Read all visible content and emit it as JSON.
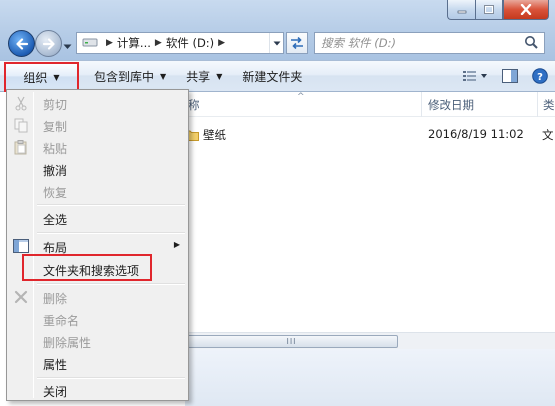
{
  "address": {
    "crumbs": [
      "计算...",
      "软件 (D:)"
    ],
    "separator": "▶"
  },
  "search": {
    "placeholder": "搜索 软件 (D:)"
  },
  "toolbar": {
    "organize": "组织",
    "include_in_library": "包含到库中",
    "share": "共享",
    "new_folder": "新建文件夹",
    "dropdown_glyph": "▼"
  },
  "columns": {
    "name": "称",
    "date": "修改日期",
    "type": "类",
    "sort_glyph": "^"
  },
  "files": [
    {
      "name": "壁纸",
      "date": "2016/8/19 11:02",
      "type": "文"
    }
  ],
  "scrollbar": {
    "grip": "III"
  },
  "menu": {
    "items": [
      {
        "label": "剪切",
        "enabled": false,
        "icon": "scissors-icon"
      },
      {
        "label": "复制",
        "enabled": false,
        "icon": "copy-icon"
      },
      {
        "label": "粘贴",
        "enabled": false,
        "icon": "paste-icon"
      },
      {
        "label": "撤消",
        "enabled": true,
        "icon": ""
      },
      {
        "label": "恢复",
        "enabled": false,
        "icon": ""
      },
      {
        "label": "全选",
        "enabled": true,
        "icon": ""
      },
      {
        "label": "布局",
        "enabled": true,
        "icon": "layout-icon",
        "submenu": true
      },
      {
        "label": "文件夹和搜索选项",
        "enabled": true,
        "icon": ""
      },
      {
        "label": "删除",
        "enabled": false,
        "icon": "delete-x-icon"
      },
      {
        "label": "重命名",
        "enabled": false,
        "icon": ""
      },
      {
        "label": "删除属性",
        "enabled": false,
        "icon": ""
      },
      {
        "label": "属性",
        "enabled": true,
        "icon": ""
      },
      {
        "label": "关闭",
        "enabled": true,
        "icon": ""
      }
    ],
    "submenu_glyph": "▶"
  },
  "colors": {
    "highlight_red": "#e0262c",
    "frame_blue": "#b9d1ea",
    "disabled_text": "#9a9a9a"
  }
}
